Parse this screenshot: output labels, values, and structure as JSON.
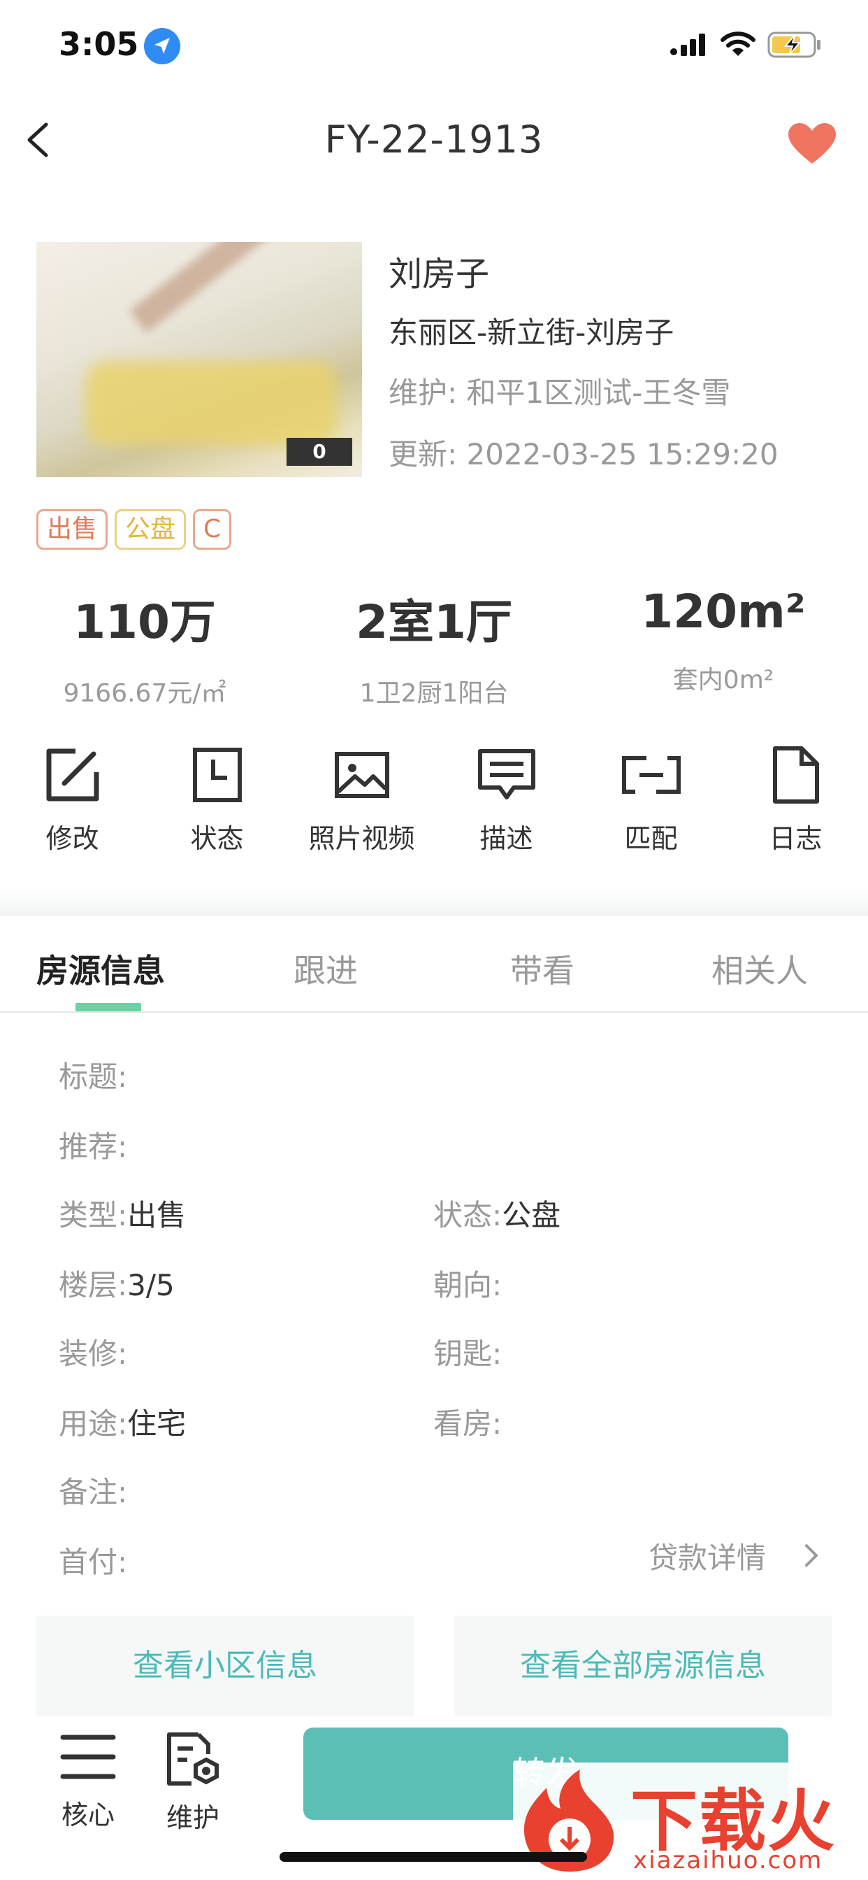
{
  "status_bar": {
    "time": "3:05"
  },
  "nav": {
    "title": "FY-22-1913"
  },
  "listing": {
    "photo_count": "0",
    "name": "刘房子",
    "address": "东丽区-新立街-刘房子",
    "maintainer": "维护:  和平1区测试-王冬雪",
    "updated": "更新:  2022-03-25 15:29:20",
    "tags": [
      "出售",
      "公盘",
      "C"
    ]
  },
  "stats": [
    {
      "main": "110万",
      "sub": "9166.67元/㎡"
    },
    {
      "main": "2室1厅",
      "sub": "1卫2厨1阳台"
    },
    {
      "main": "120m²",
      "sub": "套内0m²"
    }
  ],
  "actions": [
    {
      "label": "修改",
      "icon": "edit-icon"
    },
    {
      "label": "状态",
      "icon": "status-icon"
    },
    {
      "label": "照片视频",
      "icon": "image-icon"
    },
    {
      "label": "描述",
      "icon": "comment-icon"
    },
    {
      "label": "匹配",
      "icon": "match-icon"
    },
    {
      "label": "日志",
      "icon": "document-icon"
    }
  ],
  "tabs": [
    "房源信息",
    "跟进",
    "带看",
    "相关人"
  ],
  "fields": {
    "title": {
      "label": "标题:",
      "value": ""
    },
    "recommend": {
      "label": "推荐:",
      "value": ""
    },
    "type": {
      "label": "类型:",
      "value": "出售"
    },
    "state": {
      "label": "状态:",
      "value": "公盘"
    },
    "floor": {
      "label": "楼层:",
      "value": "3/5"
    },
    "orientation": {
      "label": "朝向:",
      "value": ""
    },
    "decoration": {
      "label": "装修:",
      "value": ""
    },
    "key": {
      "label": "钥匙:",
      "value": ""
    },
    "usage": {
      "label": "用途:",
      "value": "住宅"
    },
    "viewing": {
      "label": "看房:",
      "value": ""
    },
    "remark": {
      "label": "备注:",
      "value": ""
    },
    "down_payment": {
      "label": "首付:",
      "value": ""
    }
  },
  "loan_link": "贷款详情",
  "buttons": {
    "community": "查看小区信息",
    "all_info": "查看全部房源信息"
  },
  "bottom": {
    "core": "核心",
    "maintain": "维护",
    "main_action": "转发"
  },
  "watermark": {
    "text": "下载火",
    "url": "xiazaihuo.com"
  },
  "colors": {
    "accent": "#5bbfb8",
    "indicator": "#6ad3a3",
    "heart": "#ef7561",
    "tag_orange": "#e07a5a",
    "tag_yellow": "#e3b53a"
  }
}
